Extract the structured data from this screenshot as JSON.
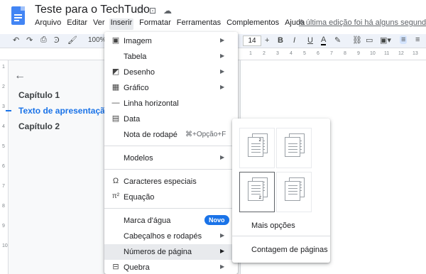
{
  "document": {
    "title": "Teste para o TechTudo",
    "last_edit": "A última edição foi há alguns segundos"
  },
  "menubar": [
    "Arquivo",
    "Editar",
    "Ver",
    "Inserir",
    "Formatar",
    "Ferramentas",
    "Complementos",
    "Ajuda"
  ],
  "toolbar": {
    "zoom": "100%",
    "font_size": "14",
    "bold": "B",
    "italic": "I",
    "underline": "U",
    "text_color": "A"
  },
  "ruler": [
    "1",
    "2",
    "3",
    "4",
    "5",
    "6",
    "7",
    "8",
    "9",
    "10",
    "11",
    "12",
    "13"
  ],
  "ruler_vertical": [
    "1",
    "2",
    "3",
    "4",
    "5",
    "6",
    "7",
    "8",
    "9",
    "10"
  ],
  "outline": {
    "items": [
      "Capítulo 1",
      "Texto de apresentação.",
      "Capítulo 2"
    ]
  },
  "insert_menu": {
    "items": [
      {
        "label": "Imagem",
        "icon": "image-icon",
        "glyph": "▣"
      },
      {
        "label": "Tabela",
        "icon": "",
        "glyph": ""
      },
      {
        "label": "Desenho",
        "icon": "drawing-icon",
        "glyph": "◩"
      },
      {
        "label": "Gráfico",
        "icon": "chart-icon",
        "glyph": "▦"
      },
      {
        "label": "Linha horizontal",
        "icon": "horizontal-line-icon",
        "glyph": "—"
      },
      {
        "label": "Data",
        "icon": "date-icon",
        "glyph": "▤"
      },
      {
        "label": "Nota de rodapé",
        "shortcut": "⌘+Opção+F"
      },
      {
        "label": "Modelos"
      },
      {
        "label": "Caracteres especiais",
        "icon": "omega-icon",
        "glyph": "Ω"
      },
      {
        "label": "Equação",
        "icon": "pi-icon",
        "glyph": "π²"
      },
      {
        "label": "Marca d'água",
        "badge": "Novo"
      },
      {
        "label": "Cabeçalhos e rodapés"
      },
      {
        "label": "Números de página"
      },
      {
        "label": "Quebra",
        "icon": "break-icon",
        "glyph": "⊟"
      }
    ]
  },
  "page_numbers_submenu": {
    "items": [
      "Mais opções",
      "Contagem de páginas"
    ],
    "page_number_sample": "2"
  },
  "colors": {
    "accent": "#1a73e8",
    "docs_blue": "#4285f4",
    "highlight": "#e8eaed"
  }
}
